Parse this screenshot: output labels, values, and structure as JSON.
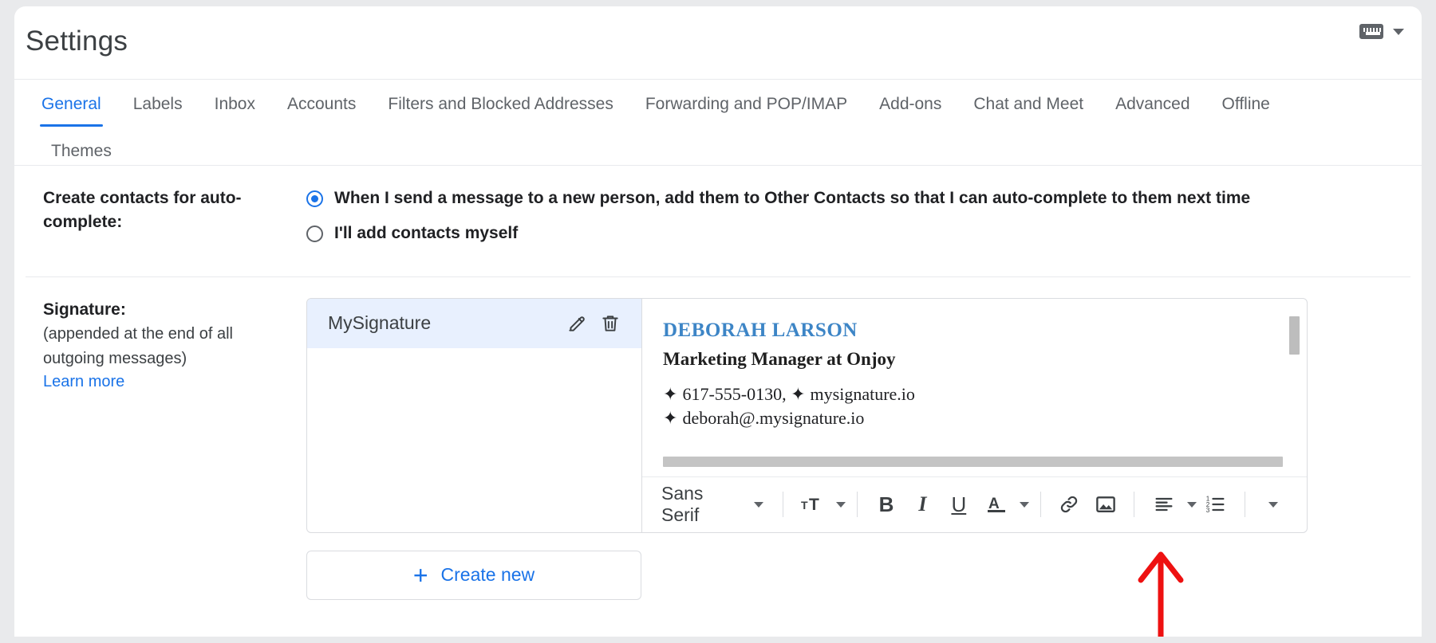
{
  "header": {
    "title": "Settings",
    "keyboard_icon": "keyboard-icon",
    "keyboard_caret": "chevron-down-icon"
  },
  "tabs": {
    "row1": [
      {
        "label": "General",
        "active": true
      },
      {
        "label": "Labels",
        "active": false
      },
      {
        "label": "Inbox",
        "active": false
      },
      {
        "label": "Accounts",
        "active": false
      },
      {
        "label": "Filters and Blocked Addresses",
        "active": false
      },
      {
        "label": "Forwarding and POP/IMAP",
        "active": false
      },
      {
        "label": "Add-ons",
        "active": false
      },
      {
        "label": "Chat and Meet",
        "active": false
      },
      {
        "label": "Advanced",
        "active": false
      },
      {
        "label": "Offline",
        "active": false
      }
    ],
    "row2": [
      {
        "label": "Themes",
        "active": false
      }
    ]
  },
  "autocomplete": {
    "label": "Create contacts for auto-complete:",
    "options": [
      {
        "text": "When I send a message to a new person, add them to Other Contacts so that I can auto-complete to them next time",
        "selected": true
      },
      {
        "text": "I'll add contacts myself",
        "selected": false
      }
    ]
  },
  "signature": {
    "label": "Signature:",
    "description_line1": "(appended at the end of all",
    "description_line2": "outgoing messages)",
    "learn_more": "Learn more",
    "items": [
      {
        "name": "MySignature",
        "edit_icon": "pencil-icon",
        "delete_icon": "trash-icon"
      }
    ],
    "preview": {
      "name": "DEBORAH LARSON",
      "name_color": "#3d85c6",
      "role": "Marketing Manager at Onjoy",
      "contact_line1_a": "617-555-0130,",
      "contact_line1_b": "mysignature.io",
      "contact_line2": "deborah@.mysignature.io",
      "bullet": "✦"
    },
    "toolbar": {
      "font_family": "Sans Serif",
      "font_size_icon": "font-size-icon",
      "bold": "B",
      "italic": "I",
      "underline": "U",
      "text_color": "A",
      "link_icon": "link-icon",
      "image_icon": "insert-image-icon",
      "align_icon": "align-left-icon",
      "list_icon": "numbered-list-icon",
      "more_icon": "more-options-icon"
    },
    "create_new": {
      "plus": "+",
      "label": "Create new"
    }
  },
  "annotation": {
    "arrow_color": "#ee1111",
    "points_at": "insert-image-icon"
  }
}
